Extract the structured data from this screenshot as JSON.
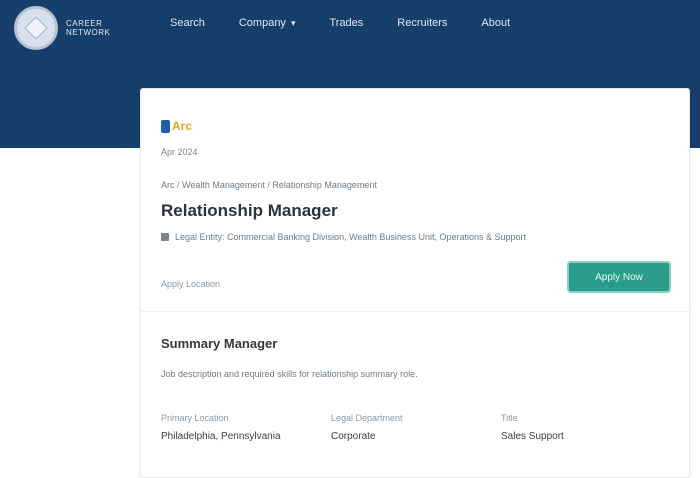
{
  "header": {
    "logo_text": "Career Network",
    "nav": [
      {
        "label": "Search",
        "has_menu": false
      },
      {
        "label": "Company",
        "has_menu": true
      },
      {
        "label": "Trades",
        "has_menu": false
      },
      {
        "label": "Recruiters",
        "has_menu": false
      },
      {
        "label": "About",
        "has_menu": false
      }
    ]
  },
  "job": {
    "company_name": "Arc",
    "posted": "Apr 2024",
    "breadcrumb": "Arc / Wealth Management / Relationship Management",
    "title": "Relationship Manager",
    "meta": "Legal Entity: Commercial Banking Division, Wealth Business Unit, Operations & Support",
    "apply_location": "Apply Location",
    "apply_label": "Apply Now"
  },
  "summary": {
    "title": "Summary Manager",
    "description": "Job description and required skills for relationship summary role.",
    "fields": [
      {
        "label": "Primary Location",
        "value": "Philadelphia, Pennsylvania"
      },
      {
        "label": "Legal Department",
        "value": "Corporate"
      },
      {
        "label": "Title",
        "value": "Sales Support"
      }
    ]
  },
  "colors": {
    "header_bg": "#153e6b",
    "apply_button": "#2a9d8a",
    "company_accent": "#e8a11a"
  }
}
